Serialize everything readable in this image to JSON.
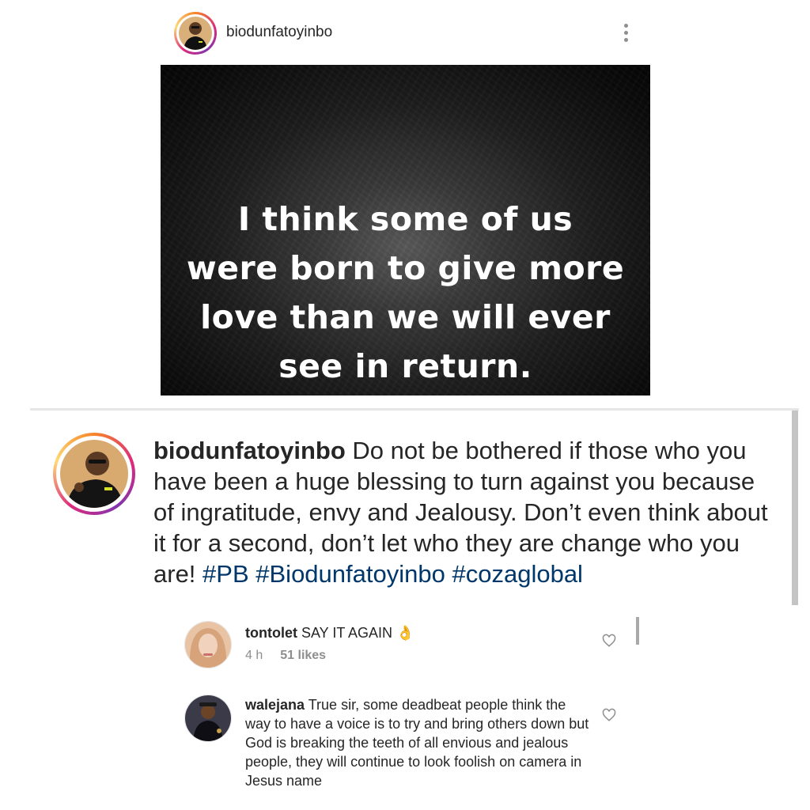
{
  "post": {
    "username": "biodunfatoyinbo",
    "image_quote_lines": [
      "I think some of us",
      "were born to give more",
      "love than we will ever",
      "see in return."
    ]
  },
  "caption": {
    "username": "biodunfatoyinbo",
    "text": " Do not be bothered if those who you have been a huge blessing to turn against you because of  ingratitude, envy and Jealousy. Don’t even think about it for a second, don’t let who they are change who you are! ",
    "hashtags": [
      "#PB",
      "#Biodunfatoyinbo",
      "#cozaglobal"
    ]
  },
  "comments": [
    {
      "username": "tontolet",
      "text": " SAY IT AGAIN 👌",
      "time": "4 h",
      "likes": "51 likes"
    },
    {
      "username": "walejana",
      "text": " True sir, some deadbeat people think the way to have a  voice is to try and bring others down but God is breaking the teeth of all envious and jealous people, they will continue to look foolish on camera in Jesus name"
    }
  ],
  "icons": {
    "more": "more-vertical-icon",
    "like": "heart-outline-icon"
  },
  "colors": {
    "hashtag": "#00376b",
    "meta": "#8e8e8e"
  }
}
